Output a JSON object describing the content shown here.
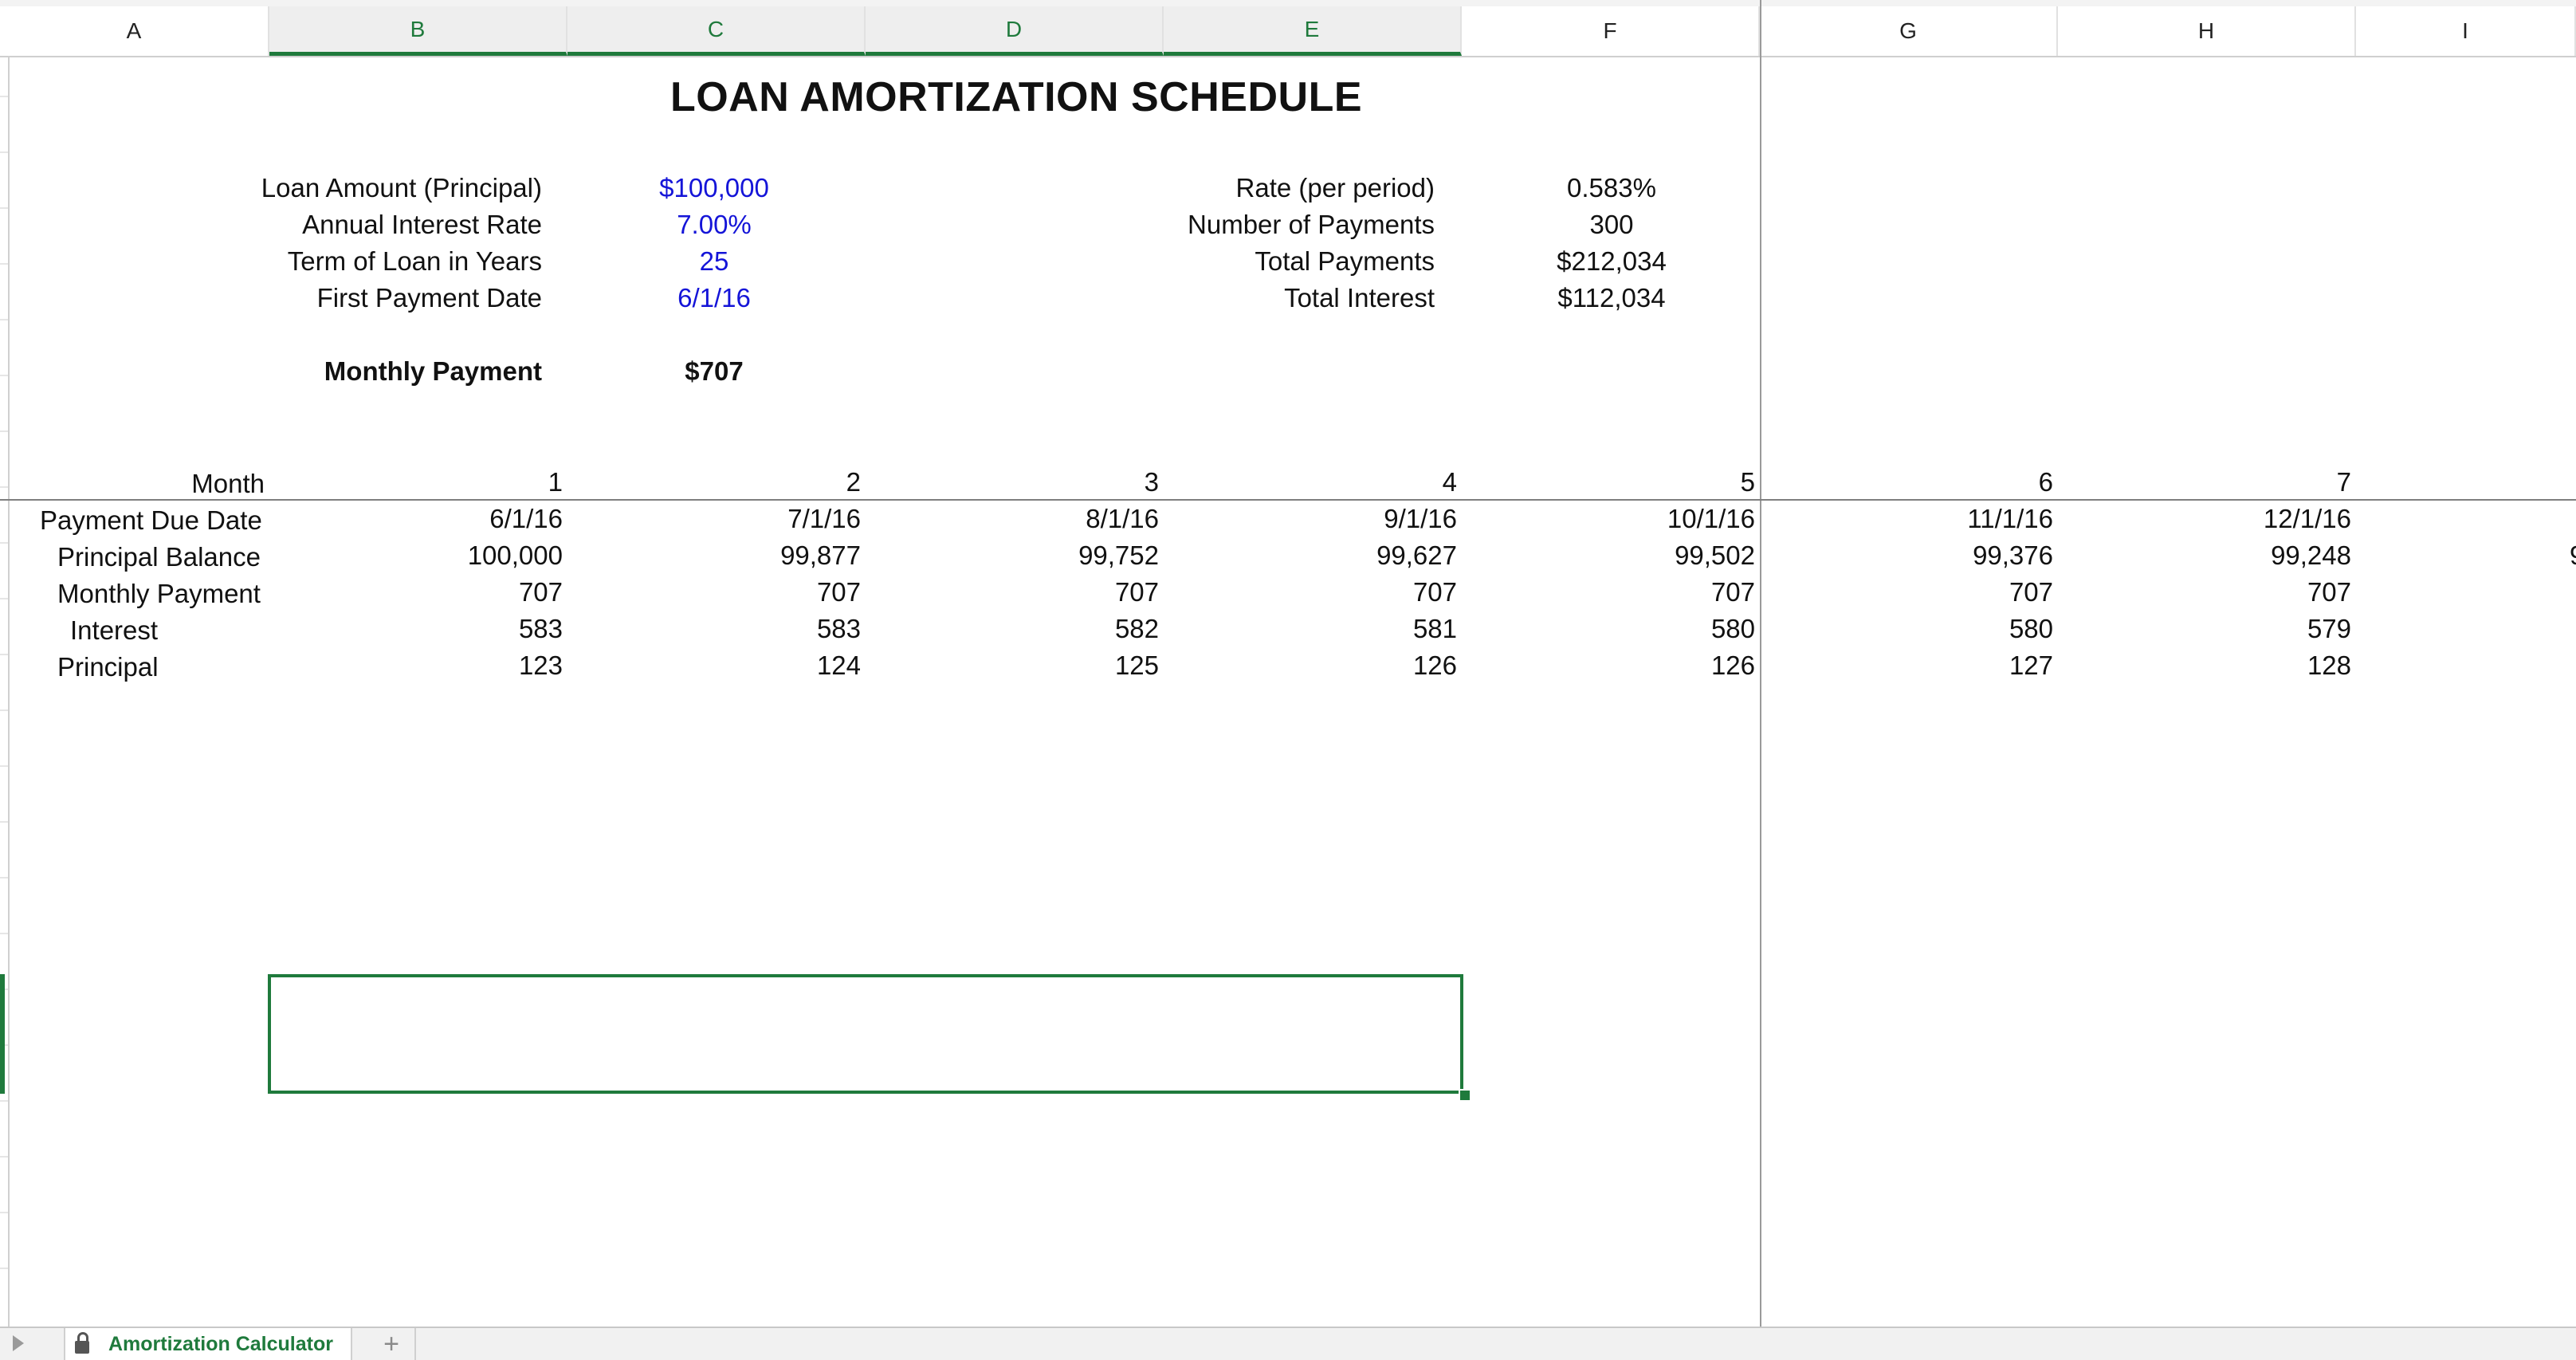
{
  "spreadsheet": {
    "columns": [
      "A",
      "B",
      "C",
      "D",
      "E",
      "F",
      "G",
      "H",
      "I"
    ],
    "selected_columns": [
      "B",
      "C",
      "D",
      "E"
    ]
  },
  "title": "LOAN AMORTIZATION SCHEDULE",
  "inputs": [
    {
      "label": "Loan Amount (Principal)",
      "value": "$100,000"
    },
    {
      "label": "Annual Interest Rate",
      "value": "7.00%"
    },
    {
      "label": "Term of Loan in Years",
      "value": "25"
    },
    {
      "label": "First Payment Date",
      "value": "6/1/16"
    }
  ],
  "monthly_payment": {
    "label": "Monthly Payment",
    "value": "$707"
  },
  "summary": [
    {
      "label": "Rate (per period)",
      "value": "0.583%"
    },
    {
      "label": "Number of Payments",
      "value": "300"
    },
    {
      "label": "Total Payments",
      "value": "$212,034"
    },
    {
      "label": "Total Interest",
      "value": "$112,034"
    }
  ],
  "schedule": {
    "row_labels": [
      "Month",
      "Payment Due Date",
      "Principal Balance",
      "Monthly Payment",
      "Interest",
      "Principal"
    ],
    "columns": [
      {
        "month": "1",
        "due": "6/1/16",
        "balance": "100,000",
        "payment": "707",
        "interest": "583",
        "principal": "123"
      },
      {
        "month": "2",
        "due": "7/1/16",
        "balance": "99,877",
        "payment": "707",
        "interest": "583",
        "principal": "124"
      },
      {
        "month": "3",
        "due": "8/1/16",
        "balance": "99,752",
        "payment": "707",
        "interest": "582",
        "principal": "125"
      },
      {
        "month": "4",
        "due": "9/1/16",
        "balance": "99,627",
        "payment": "707",
        "interest": "581",
        "principal": "126"
      },
      {
        "month": "5",
        "due": "10/1/16",
        "balance": "99,502",
        "payment": "707",
        "interest": "580",
        "principal": "126"
      },
      {
        "month": "6",
        "due": "11/1/16",
        "balance": "99,376",
        "payment": "707",
        "interest": "580",
        "principal": "127"
      },
      {
        "month": "7",
        "due": "12/1/16",
        "balance": "99,248",
        "payment": "707",
        "interest": "579",
        "principal": "128"
      }
    ],
    "partial_value": "9"
  },
  "sheet_tab": {
    "label": "Amortization Calculator",
    "lock_icon": "lock-icon"
  },
  "tab_bar": {
    "add_label": "+"
  },
  "colors": {
    "accent": "#1f7a3c",
    "input_blue": "#1414d8",
    "grid": "#d9d9d9"
  }
}
